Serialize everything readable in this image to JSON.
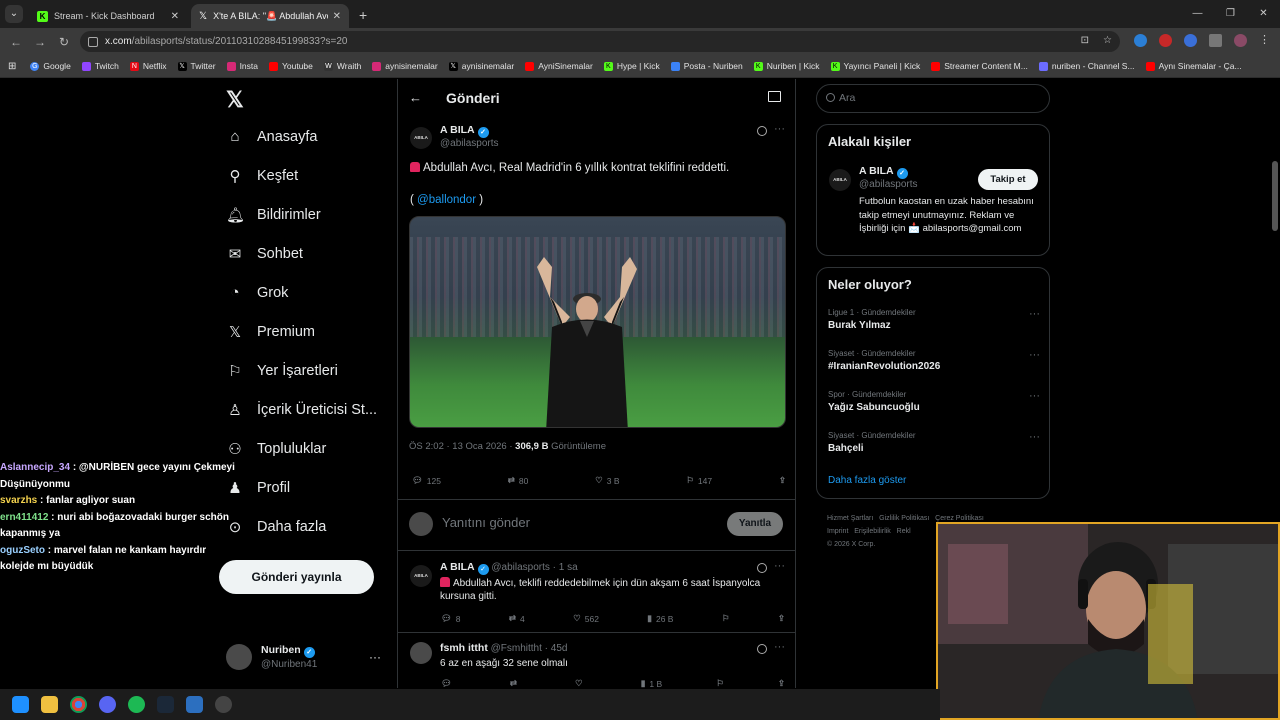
{
  "browser": {
    "tabs": [
      {
        "title": "Stream - Kick Dashboard",
        "active": false
      },
      {
        "title": "X'te A BILA: \"🚨 Abdullah Avcı,",
        "active": true
      }
    ],
    "url_domain": "x.com",
    "url_path": "/abilasports/status/2011031028845199833?s=20",
    "bookmarks": [
      "Google",
      "Twitch",
      "Netflix",
      "Twitter",
      "Insta",
      "Youtube",
      "Wraith",
      "aynisinemalar",
      "aynisinemalar",
      "AyniSinemalar",
      "Hype | Kick",
      "Posta - Nuriben",
      "Nuriben | Kick",
      "Yayıncı Paneli | Kick",
      "Streamer Content M...",
      "nuriben - Channel S...",
      "Aynı Sinemalar - Ça..."
    ]
  },
  "nav": {
    "items": [
      {
        "label": "Anasayfa",
        "icon": "home-icon"
      },
      {
        "label": "Keşfet",
        "icon": "search-icon"
      },
      {
        "label": "Bildirimler",
        "icon": "bell-icon"
      },
      {
        "label": "Sohbet",
        "icon": "mail-icon"
      },
      {
        "label": "Grok",
        "icon": "grok-icon"
      },
      {
        "label": "Premium",
        "icon": "x-premium-icon"
      },
      {
        "label": "Yer İşaretleri",
        "icon": "bookmark-icon"
      },
      {
        "label": "İçerik Üreticisi St...",
        "icon": "creator-studio-icon"
      },
      {
        "label": "Topluluklar",
        "icon": "communities-icon"
      },
      {
        "label": "Profil",
        "icon": "profile-icon"
      },
      {
        "label": "Daha fazla",
        "icon": "more-circle-icon"
      }
    ],
    "post_button": "Gönderi yayınla",
    "account": {
      "name": "Nuriben",
      "handle": "@Nuriben41"
    }
  },
  "chat": [
    {
      "user": "Aslannecip_34",
      "msg": " : @NURİBEN gece yayını Çekmeyi Düşünüyonmu"
    },
    {
      "user": "svarzhs",
      "msg": " : fanlar agliyor suan"
    },
    {
      "user": "ern411412",
      "msg": " : nuri abi boğazovadaki burger schön kapanmış ya"
    },
    {
      "user": "oguzSeto",
      "msg": " : marvel falan ne kankam hayırdır kolejde mı büyüdük"
    }
  ],
  "post": {
    "header_title": "Gönderi",
    "author_name": "A BILA",
    "author_handle": "@abilasports",
    "avatar_text": "ABILA",
    "text": "Abdullah Avcı, Real Madrid'in 6 yıllık kontrat teklifini reddetti.",
    "mention_open": "(",
    "mention": "@ballondor",
    "mention_close": ")",
    "timestamp": "ÖS 2:02 · 13 Oca 2026 · ",
    "views_count": "306,9 B",
    "views_label": " Görüntüleme",
    "replies": "125",
    "reposts": "80",
    "likes": "3 B",
    "bookmarks": "147"
  },
  "reply_box": {
    "placeholder": "Yanıtını gönder",
    "button": "Yanıtla"
  },
  "replies": [
    {
      "name": "A BILA",
      "handle": "@abilasports · 1 sa",
      "text": "Abdullah Avcı, teklifi reddedebilmek için dün akşam 6 saat İspanyolca kursuna gitti.",
      "replies": "8",
      "reposts": "4",
      "likes": "562",
      "views": "26 B"
    },
    {
      "name": "fsmh ittht",
      "handle": "@Fsmhittht · 45d",
      "text": "6 az  en aşağı 32 sene olmalı",
      "replies": "",
      "reposts": "",
      "likes": "",
      "views": "1 B"
    }
  ],
  "sidebar": {
    "search_placeholder": "Ara",
    "related_title": "Alakalı kişiler",
    "related": {
      "name": "A BILA",
      "handle": "@abilasports",
      "bio": "Futbolun kaostan en uzak haber hesabını takip etmeyi unutmayınız. Reklam ve İşbirliği için 📩 abilasports@gmail.com",
      "follow": "Takip et"
    },
    "trends_title": "Neler oluyor?",
    "trends": [
      {
        "category": "Ligue 1 · Gündemdekiler",
        "title": "Burak Yılmaz"
      },
      {
        "category": "Siyaset · Gündemdekiler",
        "title": "#IranianRevolution2026"
      },
      {
        "category": "Spor · Gündemdekiler",
        "title": "Yağız Sabuncuoğlu"
      },
      {
        "category": "Siyaset · Gündemdekiler",
        "title": "Bahçeli"
      }
    ],
    "show_more": "Daha fazla göster",
    "footer": [
      "Hizmet Şartları",
      "Gizlilik Politikası",
      "Çerez Politikası",
      "Imprint",
      "Erişilebilirlik",
      "Rekl",
      "© 2026 X Corp."
    ]
  },
  "colors": {
    "accent": "#1d9bf0",
    "kick_green": "#53fc18",
    "webcam_border": "#e2a524"
  }
}
